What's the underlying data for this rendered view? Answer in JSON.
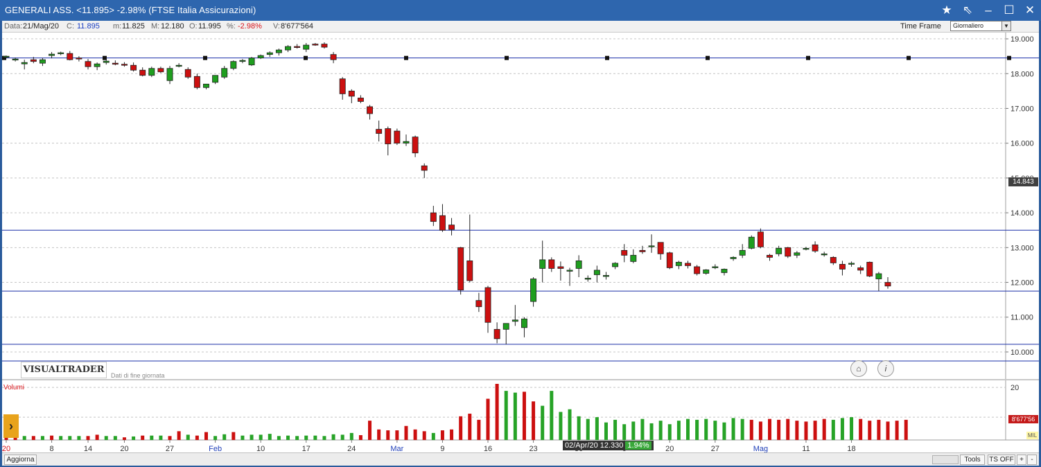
{
  "window": {
    "title": "GENERALI ASS. <11.895> -2.98%  (FTSE Italia Assicurazioni)",
    "controls": [
      "star-icon",
      "pin-icon",
      "minimize-icon",
      "maximize-icon",
      "close-icon"
    ]
  },
  "infobar": {
    "data_label": "Data:",
    "data_value": "21/Mag/20",
    "c_label": "C:",
    "c_value": "11.895",
    "m_label": "m:",
    "m_value": "11.825",
    "M_label": "M:",
    "M_value": "12.180",
    "o_label": "O:",
    "o_value": "11.995",
    "pct_label": "%:",
    "pct_value": "-2.98%",
    "v_label": "V:",
    "v_value": "8'677'564",
    "timeframe_label": "Time Frame",
    "timeframe_value": "Giornaliero"
  },
  "brand": {
    "logo": "VISUALTRADER",
    "subtitle": "Dati di fine giornata"
  },
  "volume_label": "Volumi",
  "last_price_tag": "14.843",
  "volume_tag": "8'677'56",
  "volume_unit_tag": "MIL",
  "hover": {
    "text": "02/Apr/20 12.330",
    "pct": "1.94%"
  },
  "bottombar": {
    "update_button": "Aggiorna",
    "tools_button": "Tools",
    "ts_button": "TS OFF",
    "plus": "+",
    "minus": "-"
  },
  "colors": {
    "up": "#1f9e1f",
    "down": "#cc1010",
    "hline": "#1a2fa8",
    "volume_up": "#27a327",
    "volume_down": "#cc1010"
  },
  "chart_data": {
    "type": "candlestick",
    "price_axis": {
      "ylim": [
        9.8,
        19.2
      ],
      "ticks": [
        "10.000",
        "11.000",
        "12.000",
        "13.000",
        "14.000",
        "15.000",
        "16.000",
        "17.000",
        "18.000",
        "19.000"
      ]
    },
    "volume_axis": {
      "ticks": [
        "20"
      ]
    },
    "x_tick_labels": [
      "20",
      "8",
      "14",
      "20",
      "27",
      "Feb",
      "10",
      "17",
      "24",
      "Mar",
      "9",
      "16",
      "23",
      "30",
      "6",
      "20",
      "27",
      "Mag",
      "11",
      "18"
    ],
    "horizontal_lines": [
      18.45,
      13.5,
      11.75,
      10.22,
      9.74
    ],
    "candles": [
      [
        18.48,
        18.52,
        18.44,
        18.5
      ],
      [
        18.4,
        18.46,
        18.35,
        18.42
      ],
      [
        18.28,
        18.4,
        18.12,
        18.32
      ],
      [
        18.4,
        18.48,
        18.3,
        18.35
      ],
      [
        18.3,
        18.45,
        18.22,
        18.4
      ],
      [
        18.52,
        18.62,
        18.44,
        18.56
      ],
      [
        18.57,
        18.63,
        18.53,
        18.6
      ],
      [
        18.58,
        18.65,
        18.38,
        18.4
      ],
      [
        18.45,
        18.5,
        18.35,
        18.42
      ],
      [
        18.35,
        18.42,
        18.12,
        18.2
      ],
      [
        18.2,
        18.32,
        18.1,
        18.28
      ],
      [
        18.32,
        18.4,
        18.26,
        18.36
      ],
      [
        18.3,
        18.38,
        18.24,
        18.27
      ],
      [
        18.27,
        18.33,
        18.2,
        18.24
      ],
      [
        18.24,
        18.32,
        18.06,
        18.1
      ],
      [
        18.1,
        18.18,
        17.92,
        17.95
      ],
      [
        17.95,
        18.2,
        17.9,
        18.15
      ],
      [
        18.15,
        18.2,
        18.02,
        18.05
      ],
      [
        17.8,
        18.22,
        17.7,
        18.15
      ],
      [
        18.22,
        18.3,
        18.18,
        18.24
      ],
      [
        18.12,
        18.18,
        17.85,
        17.9
      ],
      [
        17.92,
        18.0,
        17.55,
        17.6
      ],
      [
        17.6,
        17.7,
        17.55,
        17.7
      ],
      [
        17.75,
        17.95,
        17.7,
        17.95
      ],
      [
        17.9,
        18.22,
        17.85,
        18.15
      ],
      [
        18.15,
        18.38,
        18.1,
        18.35
      ],
      [
        18.35,
        18.42,
        18.3,
        18.38
      ],
      [
        18.25,
        18.48,
        18.22,
        18.45
      ],
      [
        18.45,
        18.55,
        18.42,
        18.52
      ],
      [
        18.55,
        18.64,
        18.48,
        18.6
      ],
      [
        18.6,
        18.72,
        18.52,
        18.68
      ],
      [
        18.68,
        18.82,
        18.62,
        18.78
      ],
      [
        18.78,
        18.85,
        18.72,
        18.76
      ],
      [
        18.7,
        18.88,
        18.62,
        18.82
      ],
      [
        18.85,
        18.88,
        18.8,
        18.84
      ],
      [
        18.85,
        18.9,
        18.72,
        18.76
      ],
      [
        18.55,
        18.62,
        18.3,
        18.4
      ],
      [
        17.85,
        17.9,
        17.25,
        17.42
      ],
      [
        17.5,
        17.55,
        17.15,
        17.35
      ],
      [
        17.3,
        17.38,
        17.15,
        17.2
      ],
      [
        17.05,
        17.1,
        16.68,
        16.85
      ],
      [
        16.4,
        16.65,
        16.05,
        16.28
      ],
      [
        16.42,
        16.48,
        15.65,
        15.98
      ],
      [
        16.35,
        16.42,
        15.95,
        16.0
      ],
      [
        16.0,
        16.25,
        15.92,
        16.05
      ],
      [
        16.18,
        16.22,
        15.6,
        15.72
      ],
      [
        15.35,
        15.42,
        15.0,
        15.22
      ],
      [
        14.0,
        14.2,
        13.62,
        13.75
      ],
      [
        13.92,
        14.25,
        13.45,
        13.5
      ],
      [
        13.65,
        13.85,
        13.35,
        13.52
      ],
      [
        13.0,
        13.02,
        11.65,
        11.78
      ],
      [
        12.62,
        13.95,
        12.0,
        12.05
      ],
      [
        11.48,
        11.7,
        11.15,
        11.3
      ],
      [
        11.85,
        11.9,
        10.55,
        10.85
      ],
      [
        10.65,
        10.85,
        10.25,
        10.38
      ],
      [
        10.65,
        10.8,
        10.22,
        10.82
      ],
      [
        10.88,
        11.35,
        10.75,
        10.92
      ],
      [
        10.7,
        11.0,
        10.42,
        10.95
      ],
      [
        11.45,
        12.15,
        11.3,
        12.1
      ],
      [
        12.4,
        13.2,
        12.0,
        12.65
      ],
      [
        12.65,
        12.72,
        12.3,
        12.4
      ],
      [
        12.45,
        12.6,
        12.05,
        12.4
      ],
      [
        12.35,
        12.42,
        11.9,
        12.35
      ],
      [
        12.4,
        12.78,
        12.15,
        12.62
      ],
      [
        12.12,
        12.2,
        12.02,
        12.12
      ],
      [
        12.22,
        12.48,
        12.0,
        12.35
      ],
      [
        12.2,
        12.3,
        12.08,
        12.2
      ],
      [
        12.45,
        12.58,
        12.38,
        12.55
      ],
      [
        12.92,
        13.1,
        12.58,
        12.78
      ],
      [
        12.6,
        12.95,
        12.55,
        12.78
      ],
      [
        12.92,
        13.05,
        12.82,
        12.88
      ],
      [
        13.05,
        13.38,
        12.85,
        13.05
      ],
      [
        13.15,
        13.15,
        12.65,
        12.82
      ],
      [
        12.85,
        12.88,
        12.38,
        12.42
      ],
      [
        12.48,
        12.62,
        12.38,
        12.58
      ],
      [
        12.55,
        12.62,
        12.4,
        12.48
      ],
      [
        12.45,
        12.5,
        12.2,
        12.25
      ],
      [
        12.26,
        12.38,
        12.22,
        12.36
      ],
      [
        12.42,
        12.52,
        12.38,
        12.45
      ],
      [
        12.28,
        12.4,
        12.2,
        12.38
      ],
      [
        12.68,
        12.75,
        12.62,
        12.72
      ],
      [
        12.78,
        13.1,
        12.7,
        12.92
      ],
      [
        12.98,
        13.35,
        12.95,
        13.3
      ],
      [
        13.45,
        13.55,
        12.98,
        13.02
      ],
      [
        12.78,
        12.82,
        12.62,
        12.72
      ],
      [
        12.82,
        13.05,
        12.75,
        12.98
      ],
      [
        13.0,
        13.02,
        12.7,
        12.75
      ],
      [
        12.78,
        12.9,
        12.7,
        12.85
      ],
      [
        12.95,
        13.02,
        12.92,
        12.98
      ],
      [
        13.08,
        13.18,
        12.85,
        12.9
      ],
      [
        12.82,
        12.88,
        12.74,
        12.82
      ],
      [
        12.72,
        12.75,
        12.5,
        12.56
      ],
      [
        12.52,
        12.62,
        12.2,
        12.38
      ],
      [
        12.52,
        12.6,
        12.45,
        12.55
      ],
      [
        12.42,
        12.48,
        12.24,
        12.35
      ],
      [
        12.58,
        12.6,
        12.15,
        12.18
      ],
      [
        12.1,
        12.3,
        11.75,
        12.25
      ],
      [
        12.0,
        12.15,
        11.82,
        11.895
      ]
    ],
    "volumes": [
      [
        4.5,
        0
      ],
      [
        4.5,
        0
      ],
      [
        4.5,
        1
      ],
      [
        4.5,
        0
      ],
      [
        4.5,
        1
      ],
      [
        5,
        0
      ],
      [
        4.5,
        1
      ],
      [
        4.5,
        1
      ],
      [
        4.5,
        1
      ],
      [
        4.5,
        0
      ],
      [
        6,
        0
      ],
      [
        4.5,
        1
      ],
      [
        4.5,
        1
      ],
      [
        3,
        0
      ],
      [
        4,
        1
      ],
      [
        5,
        0
      ],
      [
        5,
        1
      ],
      [
        5,
        1
      ],
      [
        4.5,
        0
      ],
      [
        10,
        0
      ],
      [
        6,
        1
      ],
      [
        5,
        0
      ],
      [
        9,
        0
      ],
      [
        4.5,
        1
      ],
      [
        6.5,
        1
      ],
      [
        9,
        0
      ],
      [
        5,
        1
      ],
      [
        6,
        1
      ],
      [
        6,
        1
      ],
      [
        7,
        1
      ],
      [
        4.5,
        1
      ],
      [
        5,
        1
      ],
      [
        4.5,
        1
      ],
      [
        5,
        1
      ],
      [
        5,
        1
      ],
      [
        4.5,
        1
      ],
      [
        6.5,
        1
      ],
      [
        6,
        1
      ],
      [
        8,
        1
      ],
      [
        5.5,
        0
      ],
      [
        22,
        0
      ],
      [
        12,
        0
      ],
      [
        11,
        0
      ],
      [
        11,
        0
      ],
      [
        16,
        0
      ],
      [
        12,
        0
      ],
      [
        10,
        0
      ],
      [
        8,
        1
      ],
      [
        11,
        0
      ],
      [
        12,
        0
      ],
      [
        27,
        0
      ],
      [
        30,
        0
      ],
      [
        23,
        0
      ],
      [
        47,
        0
      ],
      [
        64,
        0
      ],
      [
        56,
        1
      ],
      [
        54,
        1
      ],
      [
        55,
        0
      ],
      [
        44,
        0
      ],
      [
        39,
        1
      ],
      [
        56,
        1
      ],
      [
        32,
        1
      ],
      [
        35,
        1
      ],
      [
        27,
        1
      ],
      [
        24,
        1
      ],
      [
        26,
        1
      ],
      [
        20,
        1
      ],
      [
        23,
        1
      ],
      [
        18,
        1
      ],
      [
        21,
        1
      ],
      [
        24,
        1
      ],
      [
        19,
        1
      ],
      [
        22,
        1
      ],
      [
        18,
        1
      ],
      [
        22,
        1
      ],
      [
        24,
        1
      ],
      [
        23,
        1
      ],
      [
        24,
        1
      ],
      [
        22,
        1
      ],
      [
        20,
        1
      ],
      [
        25,
        1
      ],
      [
        24,
        1
      ],
      [
        23,
        0
      ],
      [
        21,
        0
      ],
      [
        24,
        0
      ],
      [
        23,
        0
      ],
      [
        24,
        0
      ],
      [
        22,
        0
      ],
      [
        21,
        0
      ],
      [
        22,
        0
      ],
      [
        24,
        0
      ],
      [
        23,
        1
      ],
      [
        25,
        1
      ],
      [
        26,
        1
      ],
      [
        24,
        0
      ],
      [
        22,
        0
      ],
      [
        23,
        0
      ],
      [
        21,
        0
      ],
      [
        22,
        0
      ],
      [
        23,
        0
      ]
    ]
  }
}
